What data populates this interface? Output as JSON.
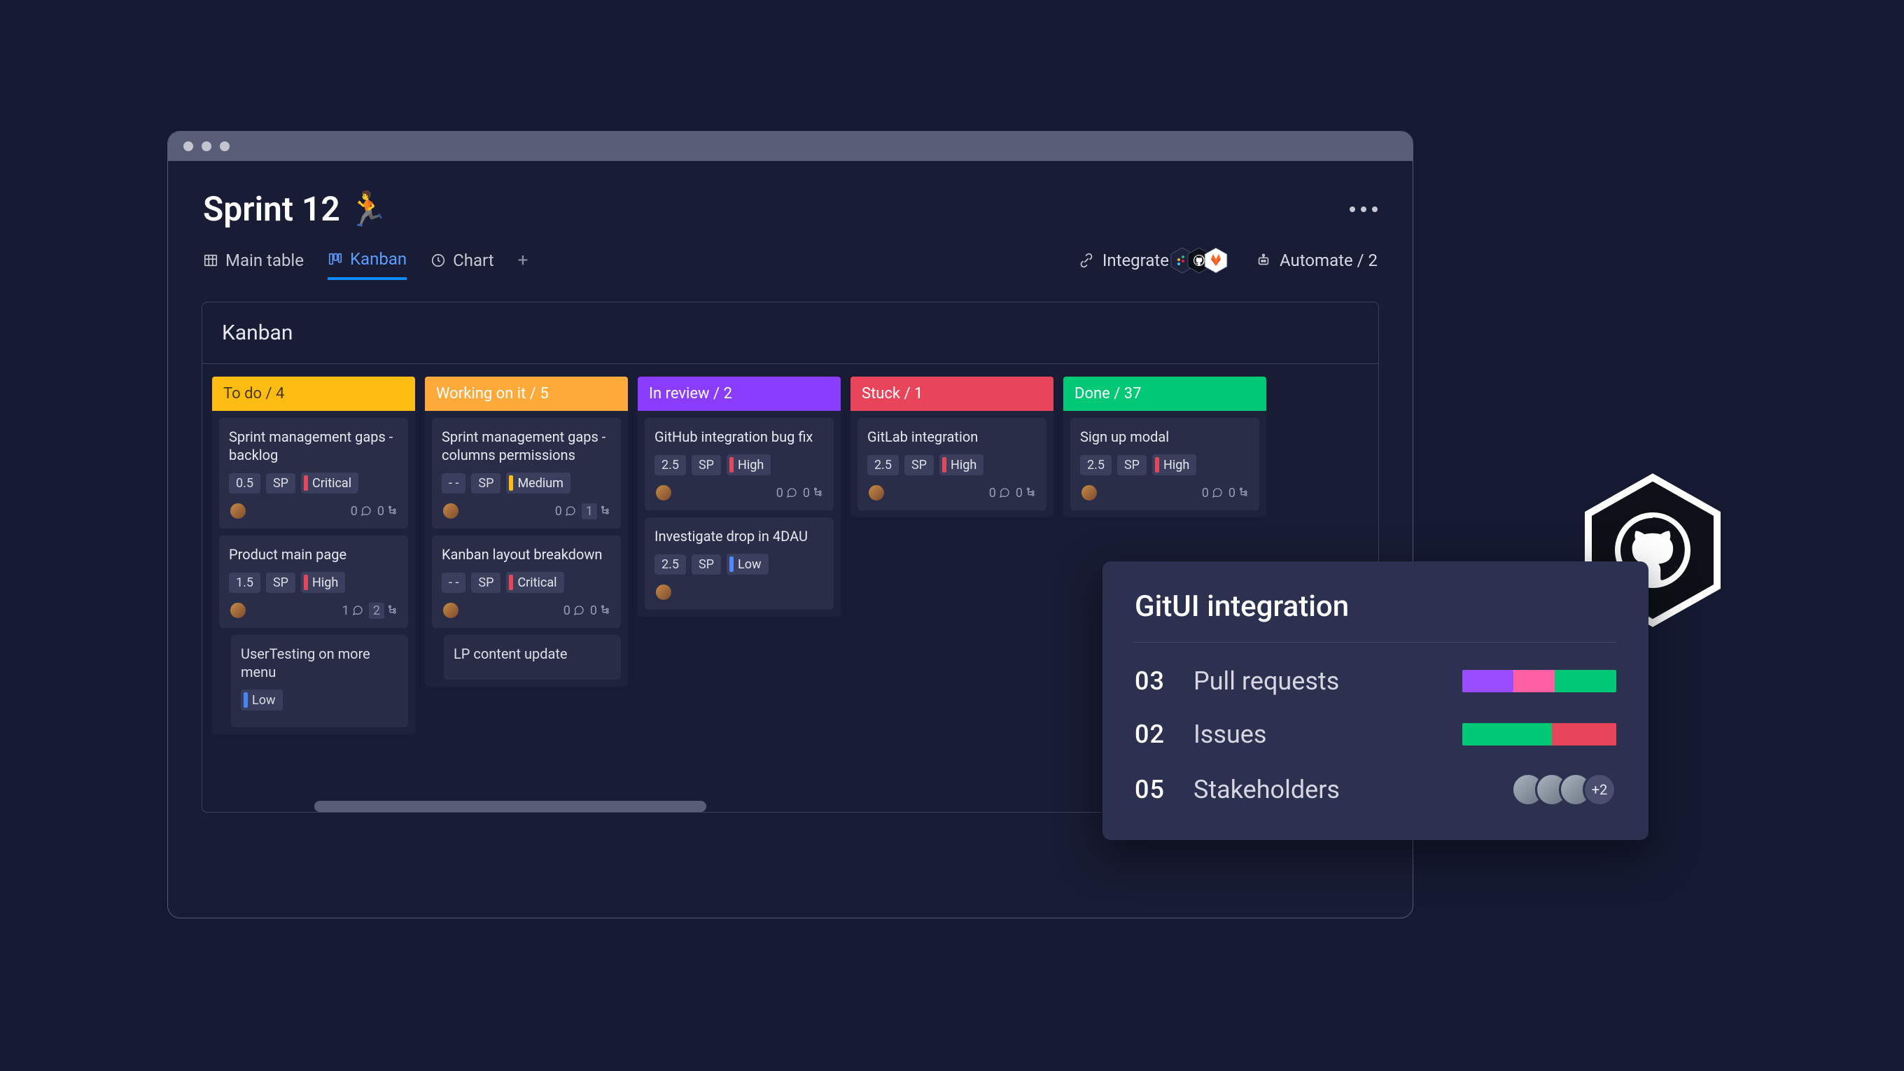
{
  "header": {
    "title": "Sprint 12",
    "emoji": "🏃"
  },
  "tabs": [
    {
      "icon": "table",
      "label": "Main table",
      "active": false
    },
    {
      "icon": "kanban",
      "label": "Kanban",
      "active": true
    },
    {
      "icon": "clock",
      "label": "Chart",
      "active": false
    }
  ],
  "actions": {
    "integrate_label": "Integrate",
    "integrations": [
      "slack",
      "github",
      "gitlab"
    ],
    "automate_label": "Automate / 2"
  },
  "board": {
    "title": "Kanban",
    "columns": [
      {
        "name": "To do",
        "count": 4,
        "color": "#fdbc11",
        "text_color": "#4a3a00",
        "cards": [
          {
            "title": "Sprint management gaps - backlog",
            "sp": "0.5",
            "sp_label": "SP",
            "priority": "Critical",
            "prio_color": "#e8455b",
            "comments": 0,
            "subitems": 0
          },
          {
            "title": "Product main page",
            "sp": "1.5",
            "sp_label": "SP",
            "priority": "High",
            "prio_color": "#e8455b",
            "comments": 1,
            "subitems": 2
          },
          {
            "title": "UserTesting on more menu",
            "priority_only": "Low",
            "prio_color": "#4b8bff",
            "partial": true
          }
        ]
      },
      {
        "name": "Working on it",
        "count": 5,
        "color": "#fdaa3a",
        "text_color": "#fff",
        "cards": [
          {
            "title": "Sprint management gaps - columns permissions",
            "sp": "- -",
            "sp_label": "SP",
            "priority": "Medium",
            "prio_color": "#fdbc11",
            "comments": 0,
            "subitems": 1
          },
          {
            "title": "Kanban layout breakdown",
            "sp": "- -",
            "sp_label": "SP",
            "priority": "Critical",
            "prio_color": "#e8455b",
            "comments": 0,
            "subitems": 0
          },
          {
            "title": "LP content update",
            "partial": true
          }
        ]
      },
      {
        "name": "In review",
        "count": 2,
        "color": "#8b3dff",
        "text_color": "#fff",
        "cards": [
          {
            "title": "GitHub integration bug fix",
            "sp": "2.5",
            "sp_label": "SP",
            "priority": "High",
            "prio_color": "#e8455b",
            "comments": 0,
            "subitems": 0
          },
          {
            "title": "Investigate drop in 4DAU",
            "sp": "2.5",
            "sp_label": "SP",
            "priority": "Low",
            "prio_color": "#4b8bff",
            "no_meta_icons": true
          }
        ]
      },
      {
        "name": "Stuck",
        "count": 1,
        "color": "#e8455b",
        "text_color": "#fff",
        "cards": [
          {
            "title": "GitLab integration",
            "sp": "2.5",
            "sp_label": "SP",
            "priority": "High",
            "prio_color": "#e8455b",
            "comments": 0,
            "subitems": 0
          }
        ]
      },
      {
        "name": "Done ",
        "count": 37,
        "color": "#00c875",
        "text_color": "#fff",
        "cards": [
          {
            "title": "Sign up modal",
            "sp": "2.5",
            "sp_label": "SP",
            "priority": "High",
            "prio_color": "#e8455b",
            "comments": 0,
            "subitems": 0
          }
        ]
      }
    ]
  },
  "overlay": {
    "title": "GitUI integration",
    "rows": [
      {
        "num": "03",
        "label": "Pull requests",
        "bar": [
          {
            "c": "#9a4dff",
            "w": 33
          },
          {
            "c": "#ff5fa3",
            "w": 27
          },
          {
            "c": "#00c875",
            "w": 40
          }
        ]
      },
      {
        "num": "02",
        "label": "Issues",
        "bar": [
          {
            "c": "#00c875",
            "w": 58
          },
          {
            "c": "#e8455b",
            "w": 42
          }
        ]
      },
      {
        "num": "05",
        "label": "Stakeholders",
        "avatars": 3,
        "more": "+2"
      }
    ]
  }
}
